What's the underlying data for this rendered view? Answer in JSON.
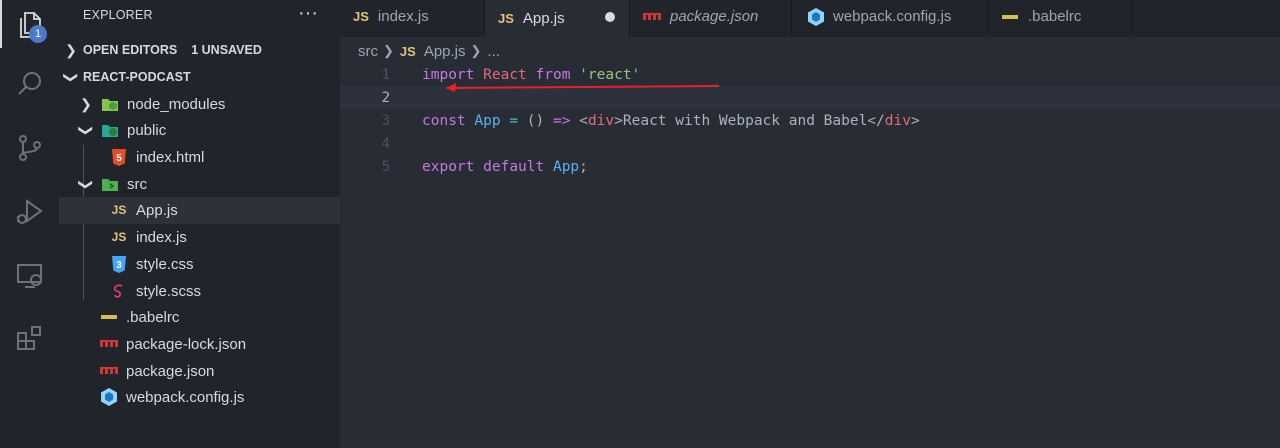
{
  "activity_bar": {
    "items": [
      {
        "icon": "files-icon",
        "badge": "1"
      },
      {
        "icon": "search-icon"
      },
      {
        "icon": "source-control-icon"
      },
      {
        "icon": "run-debug-icon"
      },
      {
        "icon": "remote-explorer-icon"
      },
      {
        "icon": "extensions-icon"
      }
    ]
  },
  "sidebar": {
    "title": "EXPLORER",
    "more": "···",
    "open_editors": {
      "label": "OPEN EDITORS",
      "count": "1 UNSAVED"
    },
    "project": {
      "label": "REACT-PODCAST"
    },
    "tree": [
      {
        "label": "node_modules",
        "type": "folder"
      },
      {
        "label": "public",
        "type": "folder"
      },
      {
        "label": "index.html",
        "type": "html"
      },
      {
        "label": "src",
        "type": "folder"
      },
      {
        "label": "App.js",
        "type": "js",
        "icon_text": "JS"
      },
      {
        "label": "index.js",
        "type": "js",
        "icon_text": "JS"
      },
      {
        "label": "style.css",
        "type": "css"
      },
      {
        "label": "style.scss",
        "type": "scss"
      },
      {
        "label": ".babelrc",
        "type": "babel"
      },
      {
        "label": "package-lock.json",
        "type": "npm"
      },
      {
        "label": "package.json",
        "type": "npm"
      },
      {
        "label": "webpack.config.js",
        "type": "webpack"
      }
    ]
  },
  "tabs": [
    {
      "label": "index.js",
      "icon_text": "JS"
    },
    {
      "label": "App.js",
      "icon_text": "JS"
    },
    {
      "label": "package.json"
    },
    {
      "label": "webpack.config.js"
    },
    {
      "label": ".babelrc"
    }
  ],
  "breadcrumb": {
    "folder": "src",
    "file": "App.js",
    "file_icon": "JS",
    "more": "..."
  },
  "editor": {
    "line_numbers": [
      "1",
      "2",
      "3",
      "4",
      "5"
    ],
    "line1": {
      "import": "import",
      "name": "React",
      "from": "from",
      "module": "'react'"
    },
    "line3": {
      "const": "const",
      "name": "App",
      "eq": "=",
      "parens": "()",
      "arrow": "=>",
      "open_lt": "<",
      "open_tag": "div",
      "open_gt": ">",
      "text": "React with Webpack and Babel",
      "close_lt": "</",
      "close_tag": "div",
      "close_gt": ">"
    },
    "line5": {
      "export": "export",
      "default": "default",
      "name": "App",
      "semi": ";"
    }
  },
  "colors": {
    "annotation_arrow": "#e8202a",
    "accent": "#4d78cc"
  }
}
